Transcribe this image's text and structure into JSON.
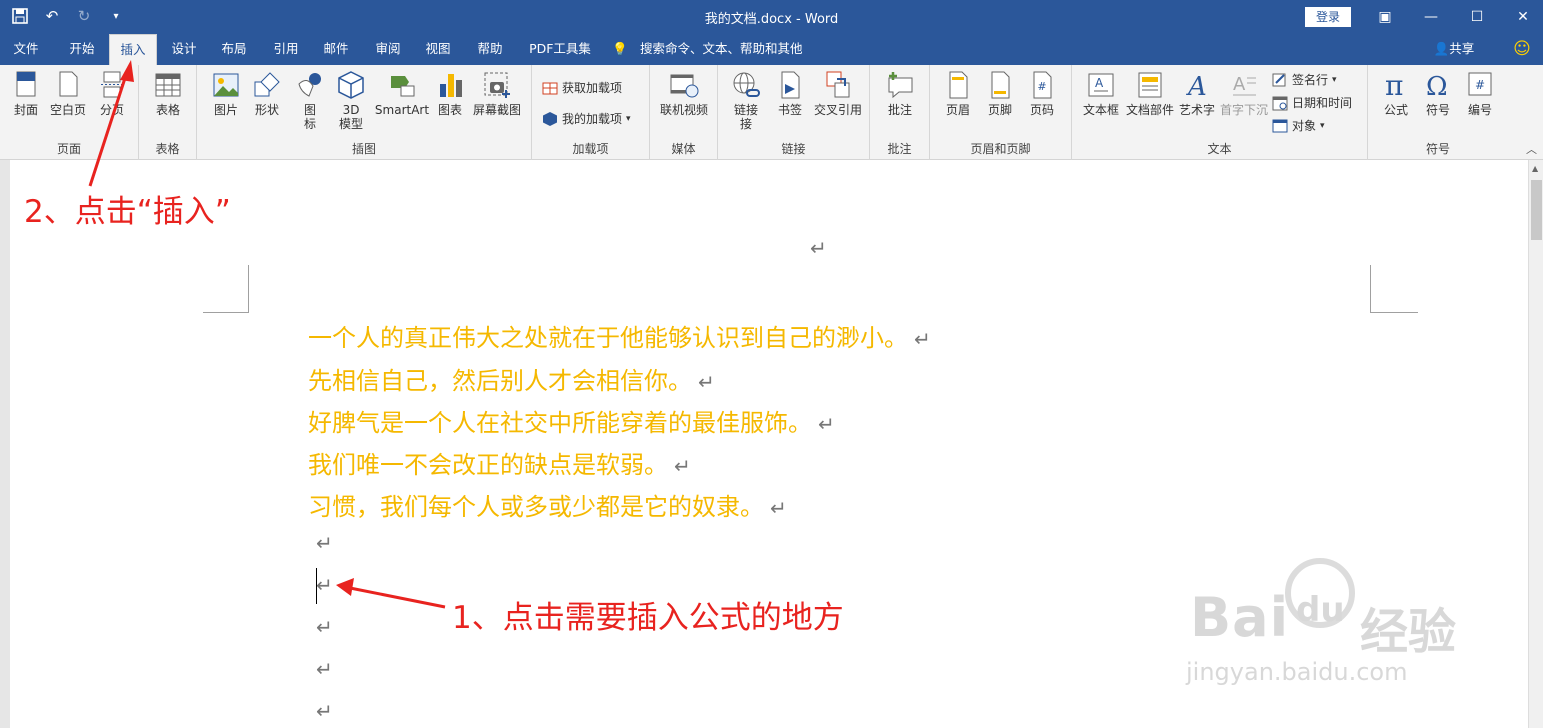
{
  "window": {
    "title": "我的文档.docx  -  Word",
    "login": "登录",
    "share": "共享"
  },
  "tabs": [
    "文件",
    "开始",
    "插入",
    "设计",
    "布局",
    "引用",
    "邮件",
    "审阅",
    "视图",
    "帮助",
    "PDF工具集"
  ],
  "search": {
    "placeholder": "搜索命令、文本、帮助和其他"
  },
  "groups": {
    "page": {
      "label": "页面",
      "items": [
        "封面",
        "空白页",
        "分页"
      ]
    },
    "table": {
      "label": "表格",
      "items": [
        "表格"
      ]
    },
    "illustration": {
      "label": "插图",
      "items": [
        "图片",
        "形状",
        "图标",
        "3D",
        "模型",
        "SmartArt",
        "图表",
        "屏幕截图"
      ]
    },
    "addins": {
      "label": "加载项",
      "items": [
        "获取加载项",
        "我的加载项"
      ]
    },
    "media": {
      "label": "媒体",
      "items": [
        "联机视频"
      ]
    },
    "links": {
      "label": "链接",
      "items": [
        "链接",
        "接",
        "书签",
        "交叉引用"
      ]
    },
    "comments": {
      "label": "批注",
      "items": [
        "批注"
      ]
    },
    "headerfooter": {
      "label": "页眉和页脚",
      "items": [
        "页眉",
        "页脚",
        "页码"
      ]
    },
    "text": {
      "label": "文本",
      "items": [
        "文本框",
        "文档部件",
        "艺术字",
        "首字下沉",
        "签名行",
        "日期和时间",
        "对象"
      ]
    },
    "symbols": {
      "label": "符号",
      "items": [
        "公式",
        "符号",
        "编号"
      ]
    }
  },
  "document": {
    "top_return": "↵",
    "paragraphs": [
      "一个人的真正伟大之处就在于他能够认识到自己的渺小。",
      "先相信自己，然后别人才会相信你。",
      "好脾气是一个人在社交中所能穿着的最佳服饰。",
      "我们唯一不会改正的缺点是软弱。",
      "习惯，我们每个人或多或少都是它的奴隶。"
    ],
    "return_mark": "↵"
  },
  "annotations": {
    "step2": "2、点击“插入”",
    "step1": "1、点击需要插入公式的地方"
  },
  "watermark": {
    "brand": "Bai",
    "du": "du",
    "cn": "经验",
    "url": "jingyan.baidu.com"
  },
  "colors": {
    "titlebar": "#2b579a",
    "text_gold": "#f5b800",
    "annotation": "#e8231f"
  }
}
